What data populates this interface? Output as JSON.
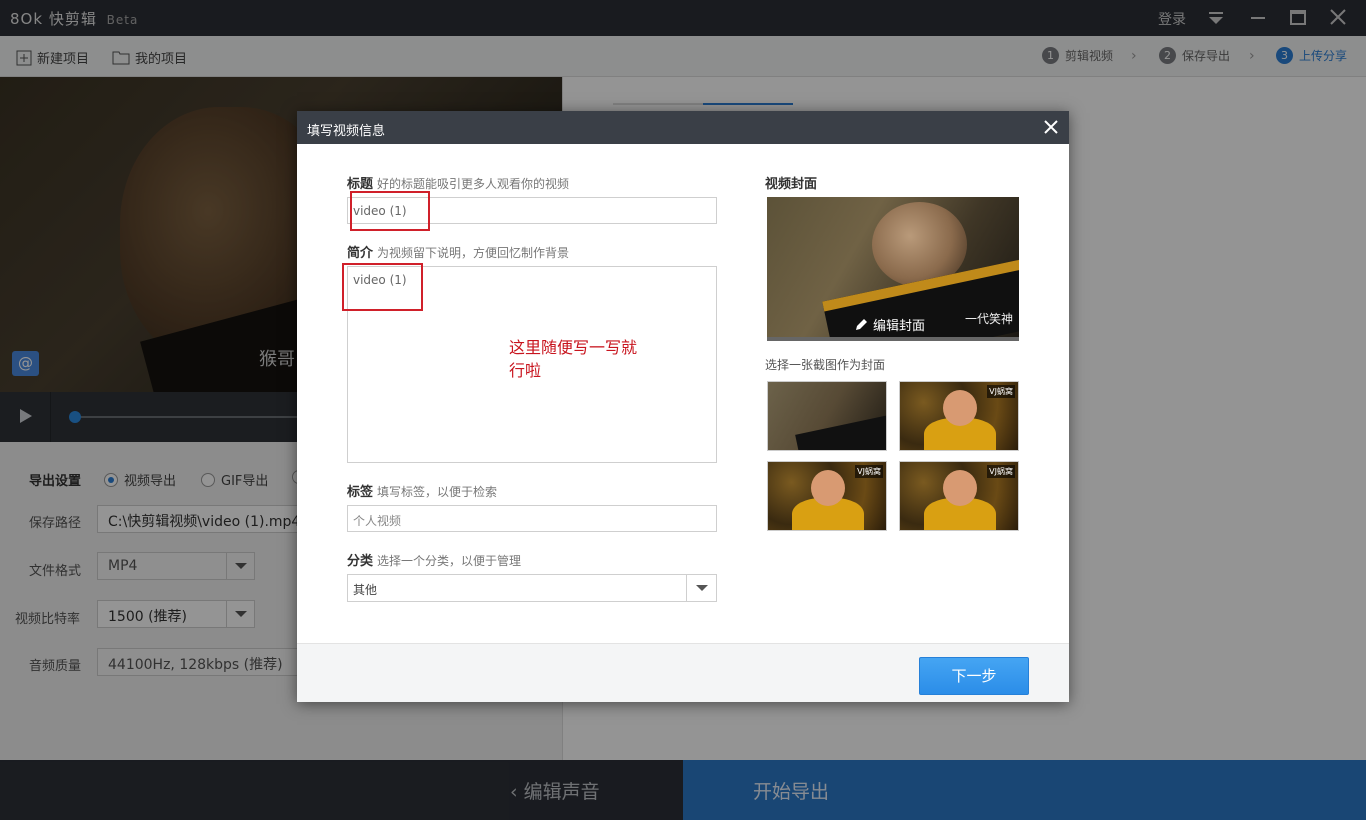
{
  "app": {
    "logo": "8Ok",
    "name": "快剪辑",
    "beta": "Beta",
    "login": "登录"
  },
  "toolbar": {
    "new_project": "新建项目",
    "my_projects": "我的项目",
    "steps": [
      {
        "num": "1",
        "label": "剪辑视频"
      },
      {
        "num": "2",
        "label": "保存导出"
      },
      {
        "num": "3",
        "label": "上传分享"
      }
    ]
  },
  "video": {
    "subtitle": "猴哥",
    "watermark": "@"
  },
  "export": {
    "section_label": "导出设置",
    "radio_video": "视频导出",
    "radio_gif": "GIF导出",
    "save_path_label": "保存路径",
    "save_path": "C:\\快剪辑视频\\video (1).mp4",
    "format_label": "文件格式",
    "format": "MP4",
    "bitrate_label": "视频比特率",
    "bitrate": "1500 (推荐)",
    "audio_label": "音频质量",
    "audio": "44100Hz, 128kbps (推荐)"
  },
  "bottom": {
    "back": "编辑声音",
    "export": "开始导出"
  },
  "dialog": {
    "title": "填写视频信息",
    "title_label": "标题",
    "title_hint": "好的标题能吸引更多人观看你的视频",
    "title_value": "video (1)",
    "intro_label": "简介",
    "intro_hint": "为视频留下说明，方便回忆制作背景",
    "intro_value": "video (1)",
    "annotation_line1": "这里随便写一写就",
    "annotation_line2": "行啦",
    "tags_label": "标签",
    "tags_hint": "填写标签，以便于检索",
    "tags_placeholder": "个人视频",
    "category_label": "分类",
    "category_hint": "选择一个分类，以便于管理",
    "category_value": "其他",
    "cover_label": "视频封面",
    "edit_cover": "编辑封面",
    "cover_brand": "一代笑神",
    "choose_hint": "选择一张截图作为封面",
    "thumb_tag": "VJ蜗窝",
    "next": "下一步"
  },
  "colors": {
    "accent": "#2b7fd6",
    "annotation": "#c8141e",
    "titlebar": "#2b2f36"
  }
}
